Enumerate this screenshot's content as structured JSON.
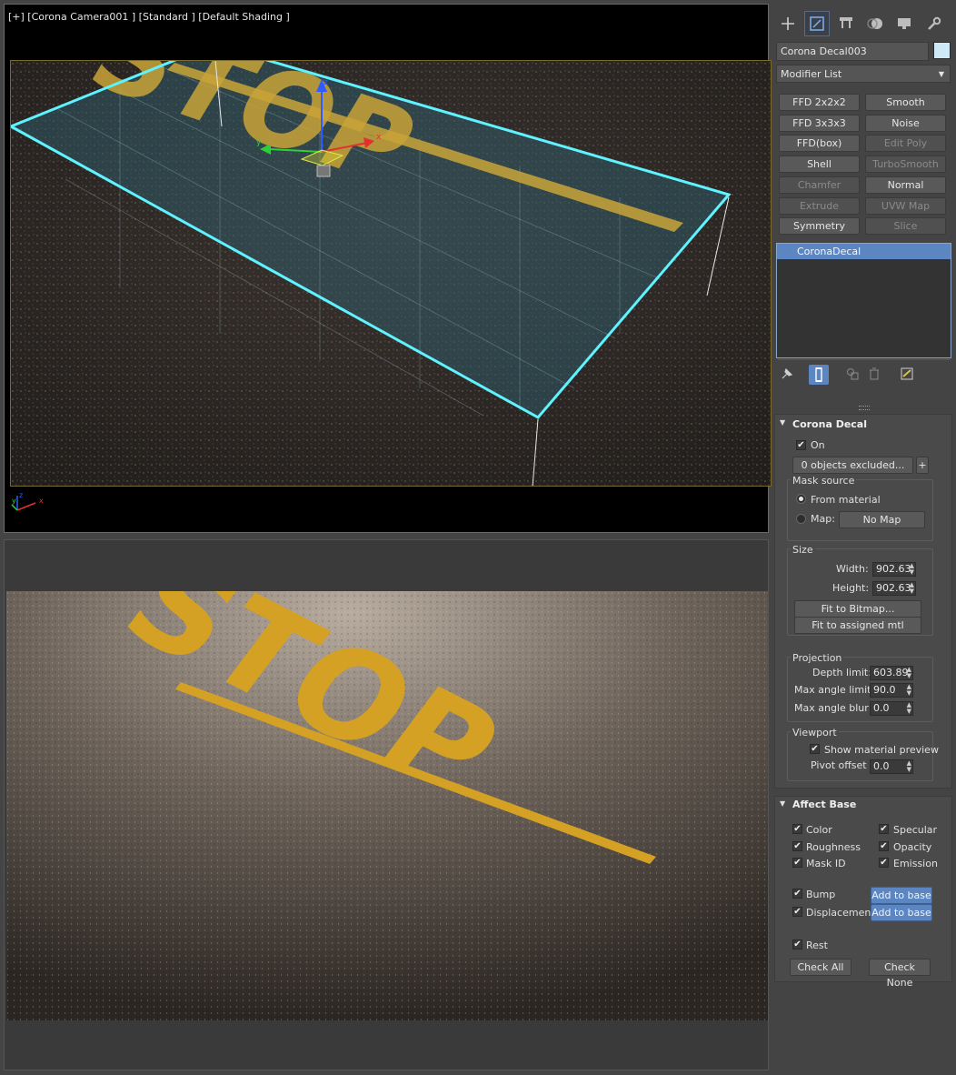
{
  "viewport_top": {
    "label": "[+] [Corona Camera001 ] [Standard ] [Default Shading ]",
    "axis_labels": {
      "x": "x",
      "y": "y",
      "z": "z"
    },
    "stop_text": "STOP"
  },
  "viewport_bottom": {
    "stop_text": "STOP"
  },
  "command_panel": {
    "tabs": [
      "create-icon",
      "modify-icon",
      "hierarchy-icon",
      "motion-icon",
      "display-icon",
      "utilities-icon"
    ],
    "object_name": "Corona Decal003",
    "object_color": "#cfe8f5",
    "modifier_list": "Modifier List",
    "modifier_buttons": [
      {
        "label": "FFD 2x2x2",
        "enabled": true
      },
      {
        "label": "Smooth",
        "enabled": true
      },
      {
        "label": "FFD 3x3x3",
        "enabled": true
      },
      {
        "label": "Noise",
        "enabled": true
      },
      {
        "label": "FFD(box)",
        "enabled": true
      },
      {
        "label": "Edit Poly",
        "enabled": false
      },
      {
        "label": "Shell",
        "enabled": true
      },
      {
        "label": "TurboSmooth",
        "enabled": false
      },
      {
        "label": "Chamfer",
        "enabled": false
      },
      {
        "label": "Normal",
        "enabled": true
      },
      {
        "label": "Extrude",
        "enabled": false
      },
      {
        "label": "UVW Map",
        "enabled": false
      },
      {
        "label": "Symmetry",
        "enabled": true
      },
      {
        "label": "Slice",
        "enabled": false
      }
    ],
    "stack": [
      "CoronaDecal"
    ],
    "stack_tools": [
      "pin-icon",
      "show-end-result-icon",
      "make-unique-icon",
      "remove-modifier-icon",
      "configure-sets-icon"
    ]
  },
  "corona_decal": {
    "title": "Corona Decal",
    "on_label": "On",
    "excluded_button": "0 objects excluded...",
    "plus": "+",
    "mask_source": {
      "title": "Mask source",
      "from_material": "From material",
      "map_label": "Map:",
      "map_button": "No Map"
    },
    "size": {
      "title": "Size",
      "width_label": "Width:",
      "width_value": "902.63",
      "height_label": "Height:",
      "height_value": "902.63",
      "fit_bitmap": "Fit to Bitmap...",
      "fit_mtl": "Fit to assigned mtl"
    },
    "projection": {
      "title": "Projection",
      "depth_label": "Depth limit:",
      "depth_value": "603.89",
      "max_angle_label": "Max angle limit:",
      "max_angle_value": "90.0",
      "blur_label": "Max angle blur:",
      "blur_value": "0.0"
    },
    "viewport": {
      "title": "Viewport",
      "show_preview": "Show material preview",
      "pivot_label": "Pivot offset",
      "pivot_value": "0.0"
    }
  },
  "affect_base": {
    "title": "Affect Base",
    "left": [
      "Color",
      "Roughness",
      "Mask ID"
    ],
    "right": [
      "Specular",
      "Opacity",
      "Emission"
    ],
    "bump": "Bump",
    "displacement": "Displacement",
    "add_to_base": "Add to base",
    "rest": "Rest",
    "check_all": "Check All",
    "check_none": "Check None"
  },
  "colors": {
    "selection_cyan": "#5ff2ff",
    "decal_yellow": "#d9a81f",
    "ui_blue": "#5b86c2"
  }
}
